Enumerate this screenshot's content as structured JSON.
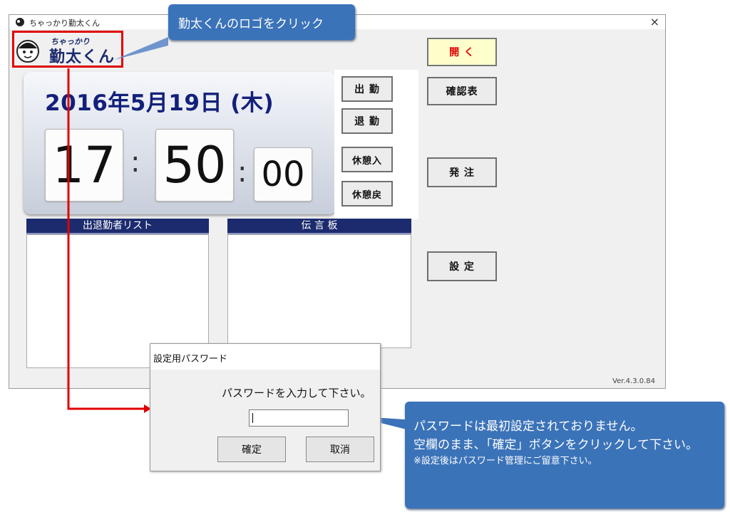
{
  "window": {
    "title": "ちゃっかり勤太くん",
    "close_label": "×",
    "version": "Ver.4.3.0.84"
  },
  "logo": {
    "top_text": "ちゃっかり",
    "main_text": "勤太くん"
  },
  "clock": {
    "date": "2016年5月19日 (木)",
    "hours": "17",
    "minutes": "50",
    "seconds": "00",
    "sep": ":"
  },
  "buttons": {
    "clock_in": "出 勤",
    "clock_out": "退 勤",
    "rest_in": "休憩入",
    "rest_out": "休憩戻",
    "open": "開 く",
    "confirm_table": "確認表",
    "order": "発 注",
    "settings": "設 定"
  },
  "lists": {
    "attendance_header": "出退勤者リスト",
    "message_board_header": "伝 言 板"
  },
  "dialog": {
    "title": "設定用パスワード",
    "message": "パスワードを入力して下さい。",
    "password_value": "",
    "ok_label": "確定",
    "cancel_label": "取消"
  },
  "callouts": {
    "logo_hint": "勤太くんのロゴをクリック",
    "password_line1": "パスワードは最初設定されておりません。",
    "password_line2": "空欄のまま､「確定」ボタンをクリックして下さい。",
    "password_note": "※設定後はパスワード管理にご留意下さい。"
  },
  "colors": {
    "accent_red": "#e00000",
    "callout_blue": "#3b73b9",
    "list_header": "#1c2b6e",
    "date_text": "#13207a"
  }
}
